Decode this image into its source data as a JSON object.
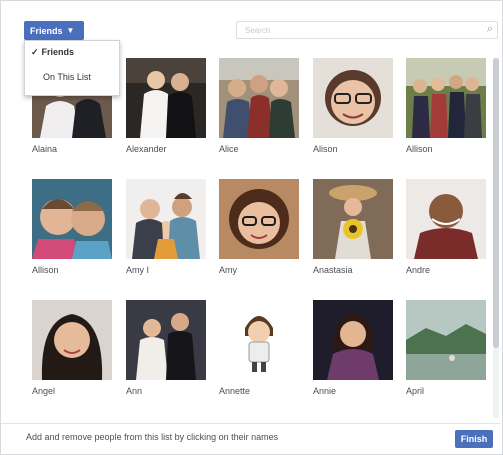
{
  "toolbar": {
    "dropdown_label": "Friends",
    "search_placeholder": "Search"
  },
  "menu": {
    "items": [
      {
        "label": "Friends",
        "checked": true
      },
      {
        "label": "On This List",
        "checked": false
      }
    ]
  },
  "people": [
    {
      "name": "Alaina",
      "icon": "photo-couple"
    },
    {
      "name": "Alexander",
      "icon": "photo-wedding"
    },
    {
      "name": "Alice",
      "icon": "photo-group"
    },
    {
      "name": "Alison",
      "icon": "photo-woman-glasses"
    },
    {
      "name": "Allison",
      "icon": "photo-group-outdoor"
    },
    {
      "name": "Allison",
      "icon": "photo-two-kids"
    },
    {
      "name": "Amy I",
      "icon": "photo-couple-baby"
    },
    {
      "name": "Amy",
      "icon": "photo-woman-glasses"
    },
    {
      "name": "Anastasia",
      "icon": "photo-flowers"
    },
    {
      "name": "Andre",
      "icon": "photo-man-smiling"
    },
    {
      "name": "Angel",
      "icon": "photo-woman-dark-hair"
    },
    {
      "name": "Ann",
      "icon": "photo-couple-formal"
    },
    {
      "name": "Annette",
      "icon": "cartoon-avatar"
    },
    {
      "name": "Annie",
      "icon": "photo-woman-night"
    },
    {
      "name": "April",
      "icon": "photo-landscape"
    }
  ],
  "footer": {
    "instruction": "Add and remove people from this list by clicking on their names",
    "finish_label": "Finish"
  },
  "colors": {
    "accent": "#4a6fbd"
  }
}
